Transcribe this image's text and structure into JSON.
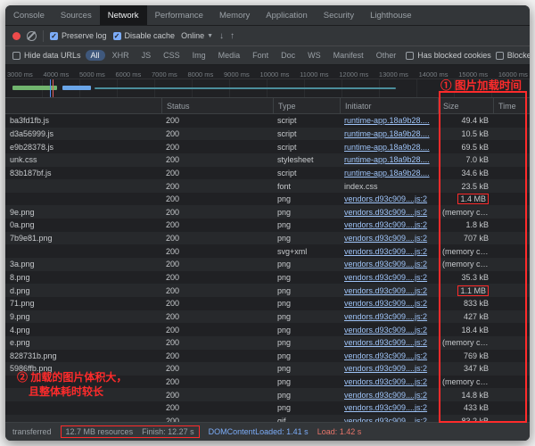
{
  "colors": {
    "annotation": "#ff2b2b",
    "accent": "#7cacf8",
    "link": "#9ec3f7"
  },
  "tabbar": {
    "tabs": [
      "Console",
      "Sources",
      "Network",
      "Performance",
      "Memory",
      "Application",
      "Security",
      "Lighthouse"
    ],
    "active": "Network"
  },
  "toolbar": {
    "preserve_log": "Preserve log",
    "disable_cache": "Disable cache",
    "throttling": "Online"
  },
  "filterbar": {
    "hide_data_urls": "Hide data URLs",
    "pills": [
      "All",
      "XHR",
      "JS",
      "CSS",
      "Img",
      "Media",
      "Font",
      "Doc",
      "WS",
      "Manifest",
      "Other"
    ],
    "active_pill": "All",
    "has_blocked_cookies": "Has blocked cookies",
    "blocked_requests": "Blocked Requests"
  },
  "timeline": {
    "ticks": [
      "3000 ms",
      "4000 ms",
      "5000 ms",
      "6000 ms",
      "7000 ms",
      "8000 ms",
      "9000 ms",
      "10000 ms",
      "11000 ms",
      "12000 ms",
      "13000 ms",
      "14000 ms",
      "15000 ms",
      "16000 ms"
    ]
  },
  "annotations": {
    "one": "① 图片加载时间",
    "two_line1": "② 加载的图片体积大，",
    "two_line2": "且整体耗时较长"
  },
  "table": {
    "columns": [
      "Status",
      "Type",
      "Initiator",
      "Size",
      "Time"
    ],
    "rows": [
      {
        "name": "ba3fd1fb.js",
        "status": "200",
        "type": "script",
        "initiator": "runtime-app.18a9b28....",
        "link": true,
        "size": "49.4 kB",
        "boxed": false
      },
      {
        "name": "d3a56999.js",
        "status": "200",
        "type": "script",
        "initiator": "runtime-app.18a9b28....",
        "link": true,
        "size": "10.5 kB",
        "boxed": false
      },
      {
        "name": "e9b28378.js",
        "status": "200",
        "type": "script",
        "initiator": "runtime-app.18a9b28....",
        "link": true,
        "size": "69.5 kB",
        "boxed": false
      },
      {
        "name": "unk.css",
        "status": "200",
        "type": "stylesheet",
        "initiator": "runtime-app.18a9b28....",
        "link": true,
        "size": "7.0 kB",
        "boxed": false
      },
      {
        "name": "83b187bf.js",
        "status": "200",
        "type": "script",
        "initiator": "runtime-app.18a9b28....",
        "link": true,
        "size": "34.6 kB",
        "boxed": false
      },
      {
        "name": "",
        "status": "200",
        "type": "font",
        "initiator": "index.css",
        "link": false,
        "size": "23.5 kB",
        "boxed": false
      },
      {
        "name": "",
        "status": "200",
        "type": "png",
        "initiator": "vendors.d93c909....js:2",
        "link": true,
        "size": "1.4 MB",
        "boxed": true
      },
      {
        "name": "9e.png",
        "status": "200",
        "type": "png",
        "initiator": "vendors.d93c909....js:2",
        "link": true,
        "size": "(memory cache)",
        "boxed": false
      },
      {
        "name": "0a.png",
        "status": "200",
        "type": "png",
        "initiator": "vendors.d93c909....js:2",
        "link": true,
        "size": "1.8 kB",
        "boxed": false
      },
      {
        "name": "7b9e81.png",
        "status": "200",
        "type": "png",
        "initiator": "vendors.d93c909....js:2",
        "link": true,
        "size": "707 kB",
        "boxed": false
      },
      {
        "name": "",
        "status": "200",
        "type": "svg+xml",
        "initiator": "vendors.d93c909....js:2",
        "link": true,
        "size": "(memory cache)",
        "boxed": false
      },
      {
        "name": "3a.png",
        "status": "200",
        "type": "png",
        "initiator": "vendors.d93c909....js:2",
        "link": true,
        "size": "(memory cache)",
        "boxed": false
      },
      {
        "name": "8.png",
        "status": "200",
        "type": "png",
        "initiator": "vendors.d93c909....js:2",
        "link": true,
        "size": "35.3 kB",
        "boxed": false
      },
      {
        "name": "d.png",
        "status": "200",
        "type": "png",
        "initiator": "vendors.d93c909....js:2",
        "link": true,
        "size": "1.1 MB",
        "boxed": true
      },
      {
        "name": "71.png",
        "status": "200",
        "type": "png",
        "initiator": "vendors.d93c909....js:2",
        "link": true,
        "size": "833 kB",
        "boxed": false
      },
      {
        "name": "9.png",
        "status": "200",
        "type": "png",
        "initiator": "vendors.d93c909....js:2",
        "link": true,
        "size": "427 kB",
        "boxed": false
      },
      {
        "name": "4.png",
        "status": "200",
        "type": "png",
        "initiator": "vendors.d93c909....js:2",
        "link": true,
        "size": "18.4 kB",
        "boxed": false
      },
      {
        "name": "e.png",
        "status": "200",
        "type": "png",
        "initiator": "vendors.d93c909....js:2",
        "link": true,
        "size": "(memory cache)",
        "boxed": false
      },
      {
        "name": "828731b.png",
        "status": "200",
        "type": "png",
        "initiator": "vendors.d93c909....js:2",
        "link": true,
        "size": "769 kB",
        "boxed": false
      },
      {
        "name": "5986ffb.png",
        "status": "200",
        "type": "png",
        "initiator": "vendors.d93c909....js:2",
        "link": true,
        "size": "347 kB",
        "boxed": false
      },
      {
        "name": "",
        "status": "200",
        "type": "png",
        "initiator": "vendors.d93c909....js:2",
        "link": true,
        "size": "(memory cache)",
        "boxed": false
      },
      {
        "name": "",
        "status": "200",
        "type": "png",
        "initiator": "vendors.d93c909....js:2",
        "link": true,
        "size": "14.8 kB",
        "boxed": false
      },
      {
        "name": "",
        "status": "200",
        "type": "png",
        "initiator": "vendors.d93c909....js:2",
        "link": true,
        "size": "433 kB",
        "boxed": false
      },
      {
        "name": "",
        "status": "200",
        "type": "gif",
        "initiator": "vendors.d93c909....js:2",
        "link": true,
        "size": "83.2 kB",
        "boxed": false
      }
    ]
  },
  "statusbar": {
    "transferred": "transferred",
    "resources": "12.7 MB resources",
    "finish": "Finish: 12.27 s",
    "domcontentloaded": "DOMContentLoaded: 1.41 s",
    "load": "Load: 1.42 s"
  }
}
